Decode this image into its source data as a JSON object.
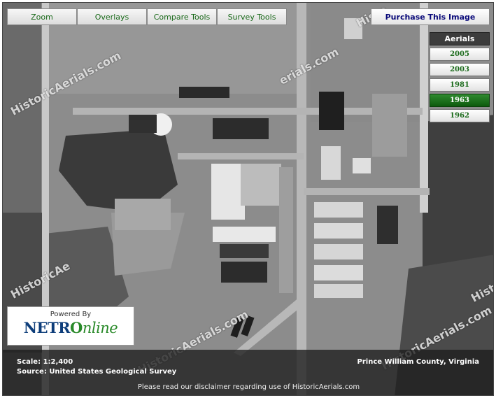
{
  "toolbar": {
    "zoom": "Zoom",
    "overlays": "Overlays",
    "compare": "Compare Tools",
    "survey": "Survey Tools"
  },
  "purchase": "Purchase This Image",
  "aerials": {
    "title": "Aerials",
    "years": [
      "2005",
      "2003",
      "1981",
      "1963",
      "1962"
    ],
    "active_year": "1963"
  },
  "watermark": {
    "text": "HistoricAerials.com",
    "partial_1": "HistoricAe",
    "partial_2": "erials.com",
    "partial_3": "Historic",
    "partial_4": "Histo"
  },
  "logo": {
    "powered_by": "Powered By",
    "brand_prefix": "NETR",
    "brand_o": "O",
    "brand_suffix": "nline"
  },
  "info": {
    "scale": "Scale: 1:2,400",
    "source": "Source: United States Geological Survey",
    "location": "Prince William County, Virginia",
    "disclaimer": "Please read our disclaimer regarding use of HistoricAerials.com"
  },
  "colors": {
    "toolbar_text": "#1a6a1a",
    "purchase_text": "#0a0a7a",
    "active_year_bg": "#1f7a1f",
    "info_bar_bg": "#1e1e1e"
  }
}
